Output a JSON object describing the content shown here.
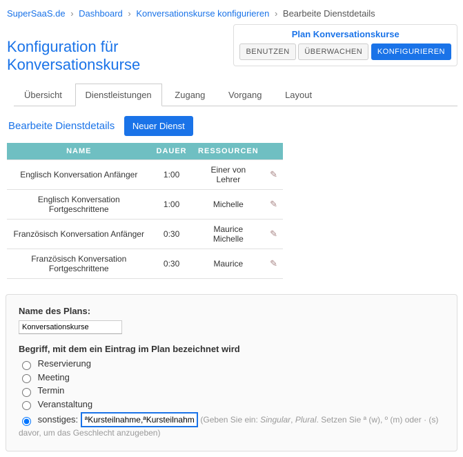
{
  "breadcrumb": {
    "items": [
      "SuperSaaS.de",
      "Dashboard",
      "Konversationskurse konfigurieren"
    ],
    "current": "Bearbeite Dienstdetails"
  },
  "planbox": {
    "title": "Plan Konversationskurse",
    "btn_use": "BENUTZEN",
    "btn_watch": "ÜBERWACHEN",
    "btn_config": "KONFIGURIEREN"
  },
  "page": {
    "title": "Konfiguration für Konversationskurse"
  },
  "tabs": {
    "overview": "Übersicht",
    "services": "Dienstleistungen",
    "access": "Zugang",
    "process": "Vorgang",
    "layout": "Layout"
  },
  "subhead": {
    "title": "Bearbeite Dienstdetails",
    "new_btn": "Neuer Dienst"
  },
  "table": {
    "head": {
      "name": "NAME",
      "duration": "DAUER",
      "resources": "RESSOURCEN"
    },
    "rows": [
      {
        "name": "Englisch Konversation Anfänger",
        "duration": "1:00",
        "resources": "Einer von Lehrer"
      },
      {
        "name": "Englisch Konversation Fortgeschrittene",
        "duration": "1:00",
        "resources": "Michelle"
      },
      {
        "name": "Französisch Konversation Anfänger",
        "duration": "0:30",
        "resources": "Maurice\nMichelle"
      },
      {
        "name": "Französisch Konversation Fortgeschrittene",
        "duration": "0:30",
        "resources": "Maurice"
      }
    ]
  },
  "form": {
    "plan_name_label": "Name des Plans:",
    "plan_name_value": "Konversationskurse",
    "term_label": "Begriff, mit dem ein Eintrag im Plan bezeichnet wird",
    "opts": {
      "reservation": "Reservierung",
      "meeting": "Meeting",
      "appointment": "Termin",
      "event": "Veranstaltung",
      "other_label": "sonstiges:",
      "other_value": "ªKursteilnahme,ªKursteilnahmen"
    },
    "hint_pre": "(Geben Sie ein: ",
    "hint_sing": "Singular",
    "hint_mid1": ", ",
    "hint_plur": "Plural",
    "hint_rest": ". Setzen Sie ª (w), º (m) oder · (s) davor, um das Geschlecht anzugeben)"
  }
}
